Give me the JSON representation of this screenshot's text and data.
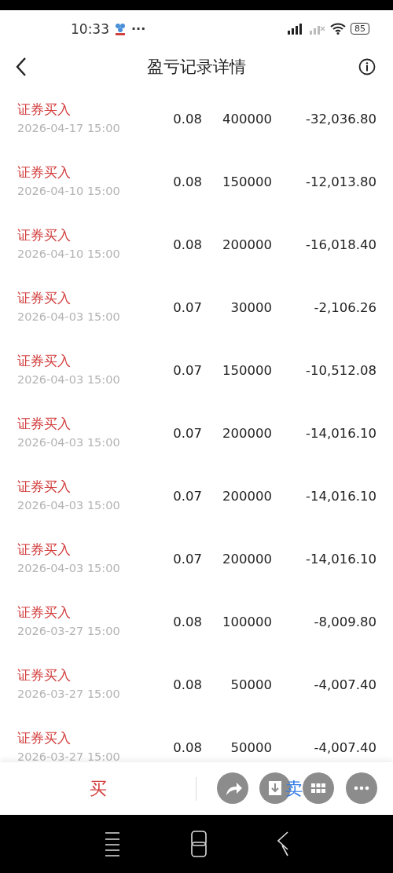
{
  "status_bar": {
    "time": "10:33",
    "more": "···",
    "battery": "85"
  },
  "header": {
    "title": "盈亏记录详情"
  },
  "records": [
    {
      "type": "证券买入",
      "date": "2026-04-17 15:00",
      "price": "0.08",
      "quantity": "400000",
      "amount": "-32,036.80"
    },
    {
      "type": "证券买入",
      "date": "2026-04-10 15:00",
      "price": "0.08",
      "quantity": "150000",
      "amount": "-12,013.80"
    },
    {
      "type": "证券买入",
      "date": "2026-04-10 15:00",
      "price": "0.08",
      "quantity": "200000",
      "amount": "-16,018.40"
    },
    {
      "type": "证券买入",
      "date": "2026-04-03 15:00",
      "price": "0.07",
      "quantity": "30000",
      "amount": "-2,106.26"
    },
    {
      "type": "证券买入",
      "date": "2026-04-03 15:00",
      "price": "0.07",
      "quantity": "150000",
      "amount": "-10,512.08"
    },
    {
      "type": "证券买入",
      "date": "2026-04-03 15:00",
      "price": "0.07",
      "quantity": "200000",
      "amount": "-14,016.10"
    },
    {
      "type": "证券买入",
      "date": "2026-04-03 15:00",
      "price": "0.07",
      "quantity": "200000",
      "amount": "-14,016.10"
    },
    {
      "type": "证券买入",
      "date": "2026-04-03 15:00",
      "price": "0.07",
      "quantity": "200000",
      "amount": "-14,016.10"
    },
    {
      "type": "证券买入",
      "date": "2026-03-27 15:00",
      "price": "0.08",
      "quantity": "100000",
      "amount": "-8,009.80"
    },
    {
      "type": "证券买入",
      "date": "2026-03-27 15:00",
      "price": "0.08",
      "quantity": "50000",
      "amount": "-4,007.40"
    },
    {
      "type": "证券买入",
      "date": "2026-03-27 15:00",
      "price": "0.08",
      "quantity": "50000",
      "amount": "-4,007.40"
    }
  ],
  "bottom_bar": {
    "buy": "买",
    "sell": "卖"
  }
}
